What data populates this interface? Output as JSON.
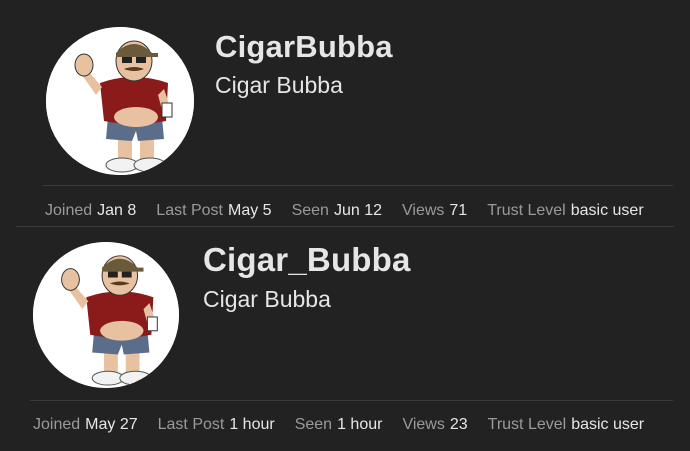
{
  "users": [
    {
      "username": "CigarBubba",
      "full_name": "Cigar Bubba",
      "stats": [
        {
          "label": "Joined",
          "value": "Jan 8"
        },
        {
          "label": "Last Post",
          "value": "May 5"
        },
        {
          "label": "Seen",
          "value": "Jun 12"
        },
        {
          "label": "Views",
          "value": "71"
        },
        {
          "label": "Trust Level",
          "value": "basic user"
        }
      ]
    },
    {
      "username": "Cigar_Bubba",
      "full_name": "Cigar Bubba",
      "stats": [
        {
          "label": "Joined",
          "value": "May 27"
        },
        {
          "label": "Last Post",
          "value": "1 hour"
        },
        {
          "label": "Seen",
          "value": "1 hour"
        },
        {
          "label": "Views",
          "value": "23"
        },
        {
          "label": "Trust Level",
          "value": "basic user"
        }
      ]
    }
  ],
  "colors": {
    "background": "#222222",
    "text_primary": "#e6e6e6",
    "text_muted": "#9a9a9a",
    "divider": "#3a3a3a"
  }
}
